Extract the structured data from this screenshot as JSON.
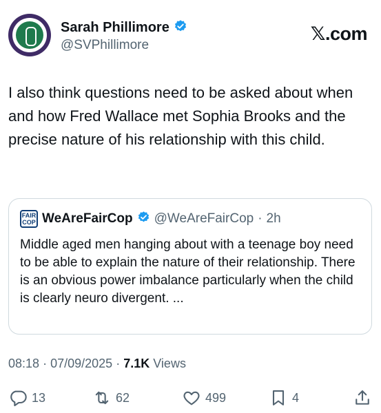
{
  "author": {
    "display_name": "Sarah Phillimore",
    "handle": "@SVPhillimore",
    "verified_icon": "verified-badge-icon"
  },
  "brand": "𝕏.com",
  "tweet": {
    "text": "I also think questions need to be asked about when and how Fred Wallace met Sophia Brooks and the precise nature of his relationship with this child."
  },
  "quote": {
    "avatar_text_top": "FAIR",
    "avatar_text_bottom": "COP",
    "display_name": "WeAreFairCop",
    "handle": "@WeAreFairCop",
    "separator": "·",
    "time": "2h",
    "text": "Middle aged men hanging about with a teenage boy need to be able to explain the nature of their relationship. There is an obvious power imbalance particularly when the child is clearly neuro divergent. ..."
  },
  "meta": {
    "time": "08:18",
    "date": "07/09/2025",
    "separator": "·",
    "views_count": "7.1K",
    "views_label": "Views"
  },
  "actions": {
    "replies": "13",
    "reposts": "62",
    "likes": "499",
    "bookmarks": "4"
  },
  "colors": {
    "text": "#0f1419",
    "secondary": "#536471",
    "verified": "#1d9bf0",
    "border": "#cfd9de"
  }
}
